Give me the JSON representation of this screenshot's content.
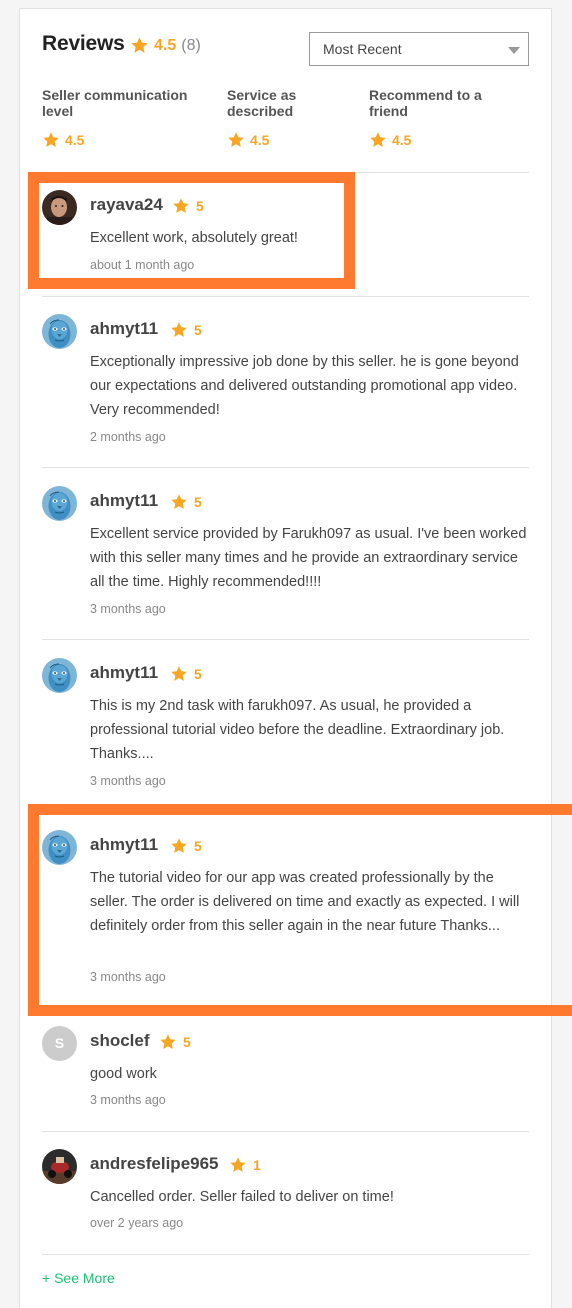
{
  "reviews_header": {
    "title": "Reviews",
    "overall_rating": "4.5",
    "count": "(8)",
    "sort": {
      "selected": "Most Recent"
    }
  },
  "subratings": [
    {
      "label": "Seller communication level",
      "value": "4.5"
    },
    {
      "label": "Service as described",
      "value": "4.5"
    },
    {
      "label": "Recommend to a friend",
      "value": "4.5"
    }
  ],
  "reviews": [
    {
      "username": "rayava24",
      "rating": "5",
      "text": "Excellent work, absolutely great!",
      "time": "about 1 month ago",
      "avatar": "photo-man"
    },
    {
      "username": "ahmyt11",
      "rating": "5",
      "text": "Exceptionally impressive job done by this seller. he is gone beyond our expectations and delivered outstanding promotional app video. Very recommended!",
      "time": "2 months ago",
      "avatar": "avatar-blue-face"
    },
    {
      "username": "ahmyt11",
      "rating": "5",
      "text": "Excellent service provided by Farukh097 as usual. I've been worked with this seller many times and he provide an extraordinary service all the time. Highly recommended!!!!",
      "time": "3 months ago",
      "avatar": "avatar-blue-face"
    },
    {
      "username": "ahmyt11",
      "rating": "5",
      "text": "This is my 2nd task with farukh097. As usual, he provided a professional tutorial video before the deadline. Extraordinary job. Thanks....",
      "time": "3 months ago",
      "avatar": "avatar-blue-face"
    },
    {
      "username": "ahmyt11",
      "rating": "5",
      "text": "The tutorial video for our app was created professionally by the seller. The order is delivered on time and exactly as expected. I will definitely order from this seller again in the near future Thanks...",
      "time": "3 months ago",
      "avatar": "avatar-blue-face"
    },
    {
      "username": "shoclef",
      "rating": "5",
      "text": "good work",
      "time": "3 months ago",
      "avatar_letter": "S"
    },
    {
      "username": "andresfelipe965",
      "rating": "1",
      "text": "Cancelled order. Seller failed to deliver on time!",
      "time": "over 2 years ago",
      "avatar": "photo-dark"
    }
  ],
  "see_more": "+ See More",
  "colors": {
    "star": "#f6a623",
    "accent": "#1dbf73",
    "highlight": "#ff7a2e"
  }
}
